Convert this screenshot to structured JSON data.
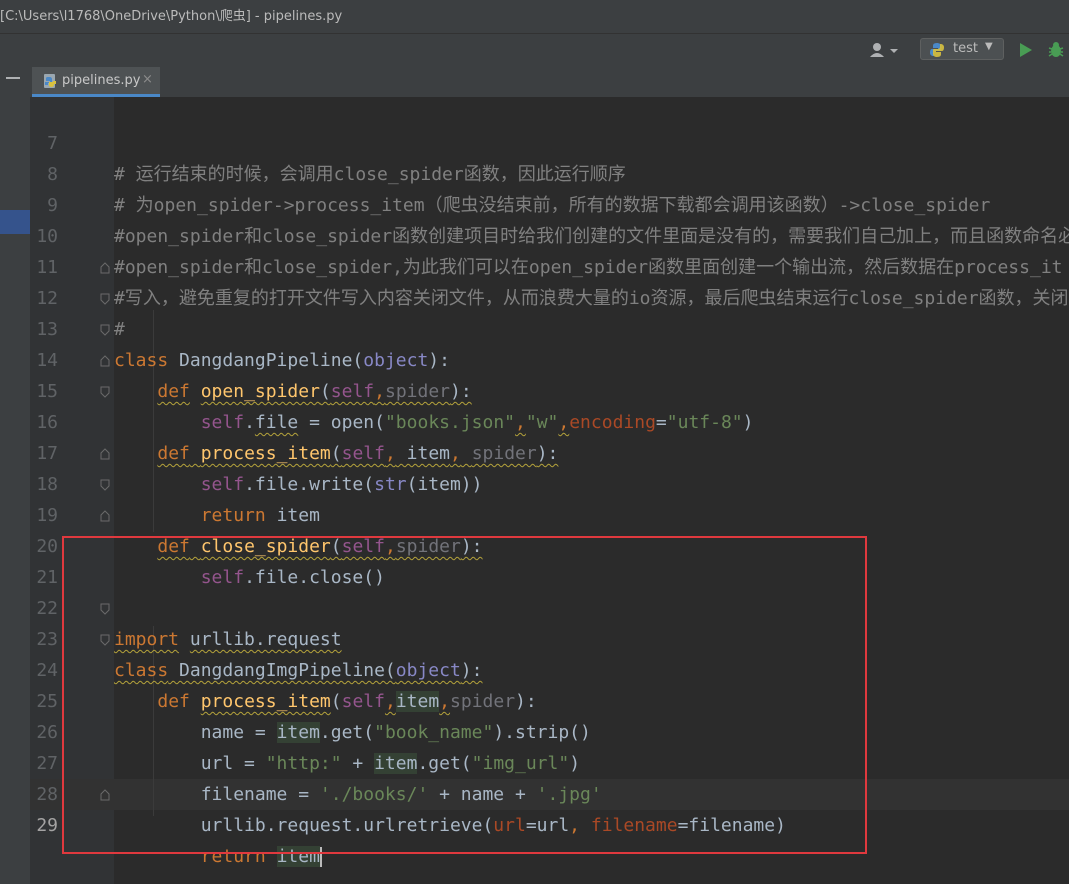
{
  "window": {
    "title": "[C:\\Users\\l1768\\OneDrive\\Python\\爬虫] - pipelines.py"
  },
  "toolbar": {
    "user_icon": "user-icon",
    "run_config_label": "test",
    "run_icon": "run-icon",
    "debug_icon": "debug-icon"
  },
  "tabs": [
    {
      "label": "pipelines.py",
      "close": "×",
      "active": true
    }
  ],
  "editor": {
    "lines": [
      {
        "n": "7"
      },
      {
        "n": "8"
      },
      {
        "n": "9"
      },
      {
        "n": "10"
      },
      {
        "n": "11"
      },
      {
        "n": "12"
      },
      {
        "n": "13"
      },
      {
        "n": "14"
      },
      {
        "n": "15"
      },
      {
        "n": "16"
      },
      {
        "n": "17"
      },
      {
        "n": "18"
      },
      {
        "n": "19"
      },
      {
        "n": "20"
      },
      {
        "n": "21"
      },
      {
        "n": "22"
      },
      {
        "n": "23"
      },
      {
        "n": "24"
      },
      {
        "n": "25"
      },
      {
        "n": "26"
      },
      {
        "n": "27"
      },
      {
        "n": "28"
      },
      {
        "n": "29"
      }
    ],
    "comment7": "# 运行结束的时候，会调用close_spider函数，因此运行顺序",
    "comment8": "# 为open_spider->process_item（爬虫没结束前，所有的数据下载都会调用该函数）->close_spider",
    "comment9": "#open_spider和close_spider函数创建项目时给我们创建的文件里面是没有的，需要我们自己加上，而且函数命名必",
    "comment10": "#open_spider和close_spider,为此我们可以在open_spider函数里面创建一个输出流，然后数据在process_it",
    "comment11": "#写入，避免重复的打开文件写入内容关闭文件，从而浪费大量的io资源，最后爬虫结束运行close_spider函数，关闭",
    "comment12": "#",
    "current_line": "29"
  },
  "colors": {
    "keyword": "#cc7832",
    "string": "#6a8759",
    "comment": "#808080",
    "function": "#ffc66d",
    "self": "#94558d",
    "annotation_box": "#e0393e"
  }
}
